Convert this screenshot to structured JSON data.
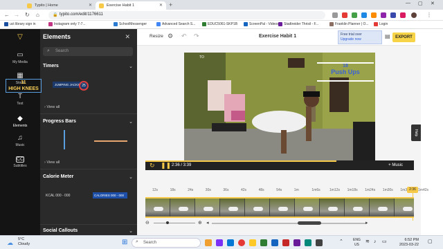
{
  "browser": {
    "tabs": [
      {
        "title": "Typito | Home",
        "favicon_color": "#f7c948"
      },
      {
        "title": "Exercise Habit 1",
        "favicon_color": "#f7c948"
      }
    ],
    "url": "typito.com/edit/1176611",
    "bookmarks": [
      {
        "label": "uct library sign in",
        "color": "#1a4fa0"
      },
      {
        "label": "Instagram only 7-7...",
        "color": "#c13584"
      },
      {
        "label": "SchoolMessenger",
        "color": "#2a7bd1"
      },
      {
        "label": "Advanced Search S...",
        "color": "#4285f4"
      },
      {
        "label": "EDUC5061-SKP1B",
        "color": "#2e7d32"
      },
      {
        "label": "ScreenPal - Videos",
        "color": "#1565c0"
      },
      {
        "label": "Stadtreider Thrisil - F...",
        "color": "#6a1b9a"
      },
      {
        "label": "Franklin Planner | O...",
        "color": "#8d6e63"
      },
      {
        "label": "Login",
        "color": "#e53935"
      }
    ]
  },
  "rail": [
    {
      "label": "",
      "icon": "typito-logo-icon",
      "glyph": "▽"
    },
    {
      "label": "My Media",
      "icon": "folder-icon",
      "glyph": "▭"
    },
    {
      "label": "Stock",
      "icon": "stock-icon",
      "glyph": "▦"
    },
    {
      "label": "Text",
      "icon": "text-icon",
      "glyph": "T"
    },
    {
      "label": "Elements",
      "icon": "elements-icon",
      "glyph": "◆"
    },
    {
      "label": "Music",
      "icon": "music-icon",
      "glyph": "♫"
    },
    {
      "label": "Subtitles",
      "icon": "subtitles-icon",
      "glyph": "CC"
    }
  ],
  "panel": {
    "title": "Elements",
    "search_placeholder": "Search",
    "sections": [
      "Timers",
      "Progress Bars",
      "Calorie Meter",
      "Social Callouts"
    ],
    "view_all": "View all",
    "timer_thumb_1": {
      "number": "11",
      "label": "HIGH KNEES"
    },
    "timer_thumb_2": {
      "label": "JUMPING JACKS",
      "number": "25"
    },
    "calorie_thumb_1": "KCAL  000 - 000",
    "calorie_thumb_2": "CALORIES  000 - 000"
  },
  "editor": {
    "resize_label": "Resize",
    "project_title": "Exercise Habit 1",
    "trial_text": "Free trial over",
    "upgrade_text": "Upgrade now",
    "export_label": "EXPORT",
    "overlay_number": "18",
    "overlay_label": "Push Ups",
    "watermark": "TO",
    "time_display": "2:36 / 3:39",
    "music_label": "+ Music",
    "help_label": "Help",
    "playhead_time": "2:36",
    "progress_fraction": 0.712,
    "ruler_ticks": [
      "12s",
      "18s",
      "24s",
      "30s",
      "36s",
      "42s",
      "48s",
      "54s",
      "1m",
      "1m6s",
      "1m12s",
      "1m18s",
      "1m24s",
      "1m30s",
      "1m36s",
      "1m42s"
    ]
  },
  "taskbar": {
    "weather_temp": "5°C",
    "weather_desc": "Cloudy",
    "search_placeholder": "Search",
    "lang_top": "ENG",
    "lang_bottom": "US",
    "time": "6:52 PM",
    "date": "2023-03-22"
  }
}
